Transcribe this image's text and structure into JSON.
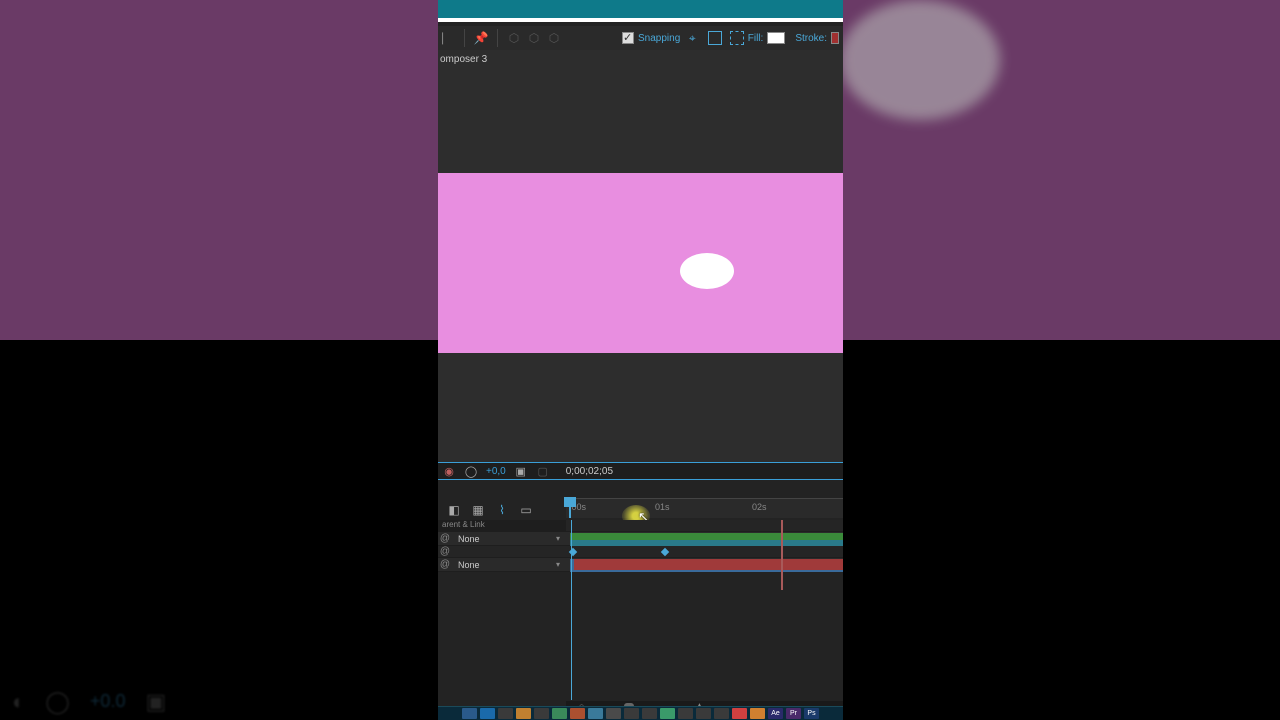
{
  "toolbar": {
    "snapping_label": "Snapping",
    "fill_label": "Fill:",
    "stroke_label": "Stroke:",
    "fill_color": "#ffffff"
  },
  "tabs": {
    "comp_name": "omposer 3"
  },
  "viewport": {
    "zoom_value": "+0,0",
    "timecode": "0;00;02;05",
    "canvas_bg": "#e88ee0"
  },
  "timeline": {
    "header_label": "arent & Link",
    "ruler": {
      "t0": ":00s",
      "t1": "01s",
      "t2": "02s"
    },
    "layers": [
      {
        "parent": "None"
      },
      {
        "parent": "None"
      }
    ]
  },
  "bg_zoom": {
    "value": "+0.0"
  },
  "taskbar_apps": [
    {
      "bg": "#2a5a8a"
    },
    {
      "bg": "#1a6aaa"
    },
    {
      "bg": "#3a3a3a"
    },
    {
      "bg": "#c08030"
    },
    {
      "bg": "#3a3a3a"
    },
    {
      "bg": "#3a8a5a"
    },
    {
      "bg": "#aa5030"
    },
    {
      "bg": "#3a7a9a"
    },
    {
      "bg": "#4a4a4a"
    },
    {
      "bg": "#3a3a3a"
    },
    {
      "bg": "#3a3a3a"
    },
    {
      "bg": "#3a9a6a"
    },
    {
      "bg": "#3a3a3a"
    },
    {
      "bg": "#3a3a3a"
    },
    {
      "bg": "#3a3a3a"
    },
    {
      "bg": "#d04040"
    },
    {
      "bg": "#d08030"
    },
    {
      "bg": "#2a2a6a",
      "t": "Ae"
    },
    {
      "bg": "#4a2a6a",
      "t": "Pr"
    },
    {
      "bg": "#1a3a6a",
      "t": "Ps"
    }
  ]
}
